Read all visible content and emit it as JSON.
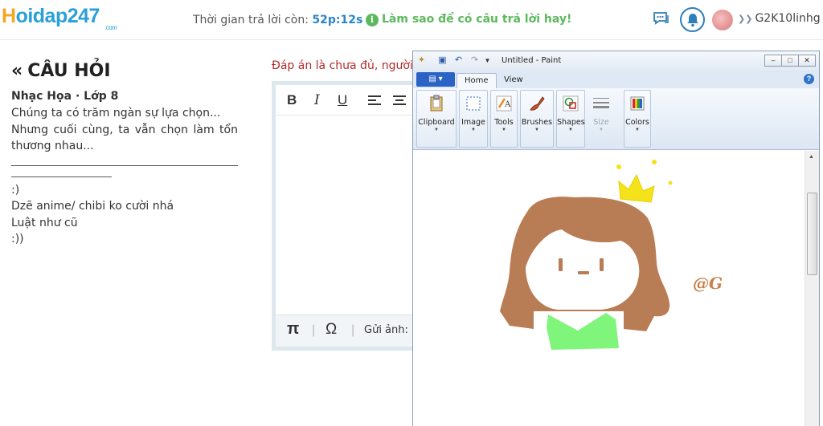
{
  "header": {
    "logo_h": "H",
    "logo_rest": "oidap247",
    "logo_com": ".com",
    "timer_label": "Thời gian trả lời còn: ",
    "timer_value": "52p:12s",
    "tip_text": "Làm sao để có câu trả lời hay!",
    "user_name": "G2K10linhg ..."
  },
  "question": {
    "title": "CÂU HỎI",
    "meta": "Nhạc Họa · Lớp 8",
    "line1": "Chúng ta có trăm ngàn sự lựa chọn...",
    "line2": "Nhưng cuối cùng, ta vẫn chọn làm tổn thương nhau...",
    "line3": ":)",
    "line4": "Dzẽ anime/ chibi ko cười nhá",
    "line5": "Luật như cũ",
    "line6": ":))"
  },
  "answer": {
    "notice": "Đáp án là chưa đủ, người h",
    "bold": "B",
    "italic": "I",
    "underline": "U",
    "pi": "π",
    "omega": "Ω",
    "send_image": "Gửi ảnh:"
  },
  "paint": {
    "title": "Untitled - Paint",
    "tab_home": "Home",
    "tab_view": "View",
    "groups": {
      "clipboard": "Clipboard",
      "image": "Image",
      "tools": "Tools",
      "brushes": "Brushes",
      "shapes": "Shapes",
      "size": "Size",
      "colors": "Colors"
    },
    "signature": "@G"
  },
  "colors": {
    "hair": "#b97d55",
    "shirt": "#80f57b",
    "crown": "#f4e21a",
    "accent": "#2b84c9",
    "tip_green": "#5cb85c",
    "notice_red": "#b52a2a"
  }
}
